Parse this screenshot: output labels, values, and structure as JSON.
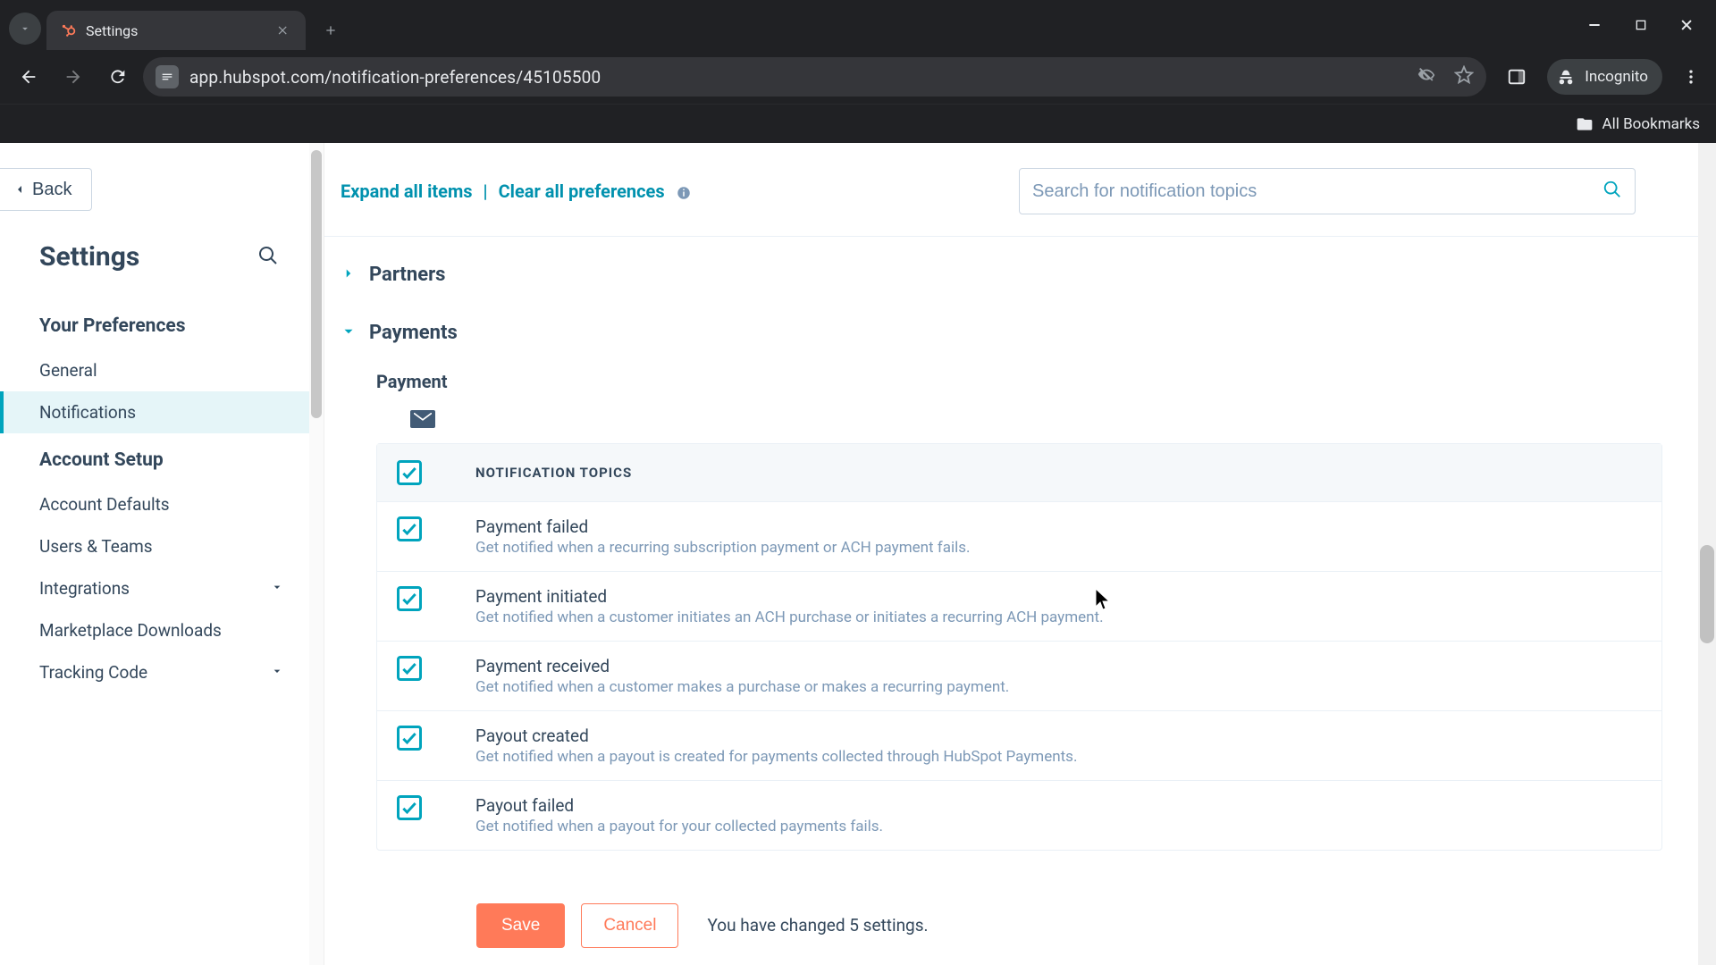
{
  "browser": {
    "tab_title": "Settings",
    "url": "app.hubspot.com/notification-preferences/45105500",
    "incognito_label": "Incognito",
    "all_bookmarks": "All Bookmarks"
  },
  "sidebar": {
    "back_label": "Back",
    "heading": "Settings",
    "sections": {
      "prefs_title": "Your Preferences",
      "general": "General",
      "notifications": "Notifications",
      "account_title": "Account Setup",
      "account_defaults": "Account Defaults",
      "users_teams": "Users & Teams",
      "integrations": "Integrations",
      "marketplace": "Marketplace Downloads",
      "tracking_code": "Tracking Code"
    }
  },
  "toolbar": {
    "expand_all": "Expand all items",
    "clear_all": "Clear all preferences",
    "search_placeholder": "Search for notification topics"
  },
  "sections": {
    "partners": "Partners",
    "payments": "Payments",
    "payment_sub": "Payment",
    "topics_header": "NOTIFICATION TOPICS"
  },
  "topics": [
    {
      "title": "Payment failed",
      "desc": "Get notified when a recurring subscription payment or ACH payment fails."
    },
    {
      "title": "Payment initiated",
      "desc": "Get notified when a customer initiates an ACH purchase or initiates a recurring ACH payment."
    },
    {
      "title": "Payment received",
      "desc": "Get notified when a customer makes a purchase or makes a recurring payment."
    },
    {
      "title": "Payout created",
      "desc": "Get notified when a payout is created for payments collected through HubSpot Payments."
    },
    {
      "title": "Payout failed",
      "desc": "Get notified when a payout for your collected payments fails."
    }
  ],
  "footer": {
    "save": "Save",
    "cancel": "Cancel",
    "msg": "You have changed 5 settings."
  }
}
